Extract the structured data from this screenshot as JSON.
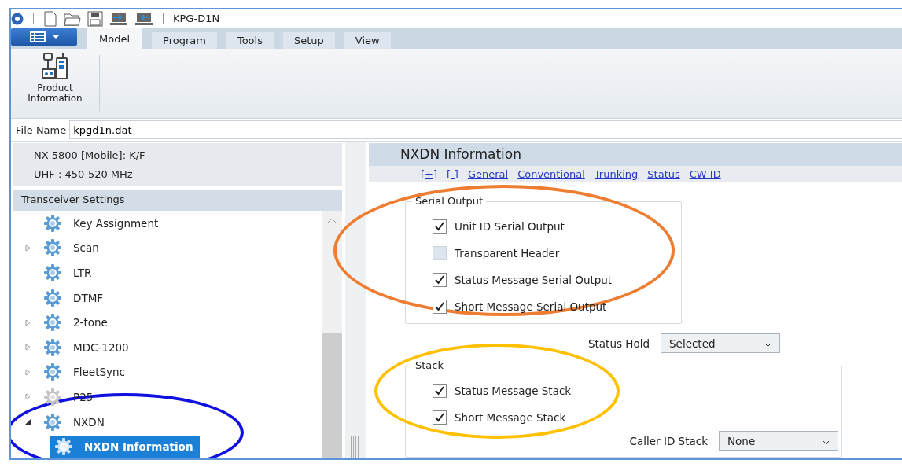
{
  "window": {
    "title": "KPG-D1N"
  },
  "ribbon": {
    "tabs": [
      {
        "label": "Model",
        "selected": true
      },
      {
        "label": "Program",
        "selected": false
      },
      {
        "label": "Tools",
        "selected": false
      },
      {
        "label": "Setup",
        "selected": false
      },
      {
        "label": "View",
        "selected": false
      }
    ],
    "buttons": [
      {
        "label": "Product Information"
      }
    ]
  },
  "file_name": {
    "label": "File Name",
    "value": "kpgd1n.dat"
  },
  "model_info": [
    "NX-5800 [Mobile]: K/F",
    "UHF : 450-520 MHz"
  ],
  "tree": {
    "title": "Transceiver Settings",
    "circle": {
      "color": "#1010e0"
    },
    "items": [
      {
        "kind": "leaf",
        "label": "Key Assignment",
        "disabled": false,
        "selected": false
      },
      {
        "kind": "folder",
        "label": "Scan",
        "expanded": false,
        "disabled": false,
        "selected": false
      },
      {
        "kind": "leaf",
        "label": "LTR",
        "disabled": false,
        "selected": false
      },
      {
        "kind": "leaf",
        "label": "DTMF",
        "disabled": false,
        "selected": false
      },
      {
        "kind": "folder",
        "label": "2-tone",
        "expanded": false,
        "disabled": false,
        "selected": false
      },
      {
        "kind": "folder",
        "label": "MDC-1200",
        "expanded": false,
        "disabled": false,
        "selected": false
      },
      {
        "kind": "folder",
        "label": "FleetSync",
        "expanded": false,
        "disabled": false,
        "selected": false
      },
      {
        "kind": "folder",
        "label": "P25",
        "expanded": false,
        "disabled": true,
        "selected": false
      },
      {
        "kind": "folder",
        "label": "NXDN",
        "expanded": true,
        "disabled": false,
        "selected": false,
        "children": [
          {
            "label": "NXDN Information",
            "disabled": false,
            "selected": true
          }
        ]
      }
    ]
  },
  "panel": {
    "title": "NXDN Information",
    "links": [
      "[+]",
      "[-]",
      "General",
      "Conventional",
      "Trunking",
      "Status",
      "CW ID"
    ],
    "serial_output": {
      "title": "Serial Output",
      "circle": {
        "color": "#ee7d31"
      },
      "options": [
        {
          "label": "Unit ID Serial Output",
          "checked": true
        },
        {
          "label": "Transparent Header",
          "checked": false
        },
        {
          "label": "Status Message Serial Output",
          "checked": true
        },
        {
          "label": "Short Message Serial Output",
          "checked": true
        }
      ]
    },
    "status_hold": {
      "label": "Status Hold",
      "value": "Selected"
    },
    "stack": {
      "title": "Stack",
      "circle": {
        "color": "#ffc000"
      },
      "options": [
        {
          "label": "Status Message Stack",
          "checked": true
        },
        {
          "label": "Short Message Stack",
          "checked": true
        }
      ],
      "caller_id_stack": {
        "label": "Caller ID Stack",
        "value": "None"
      }
    }
  }
}
